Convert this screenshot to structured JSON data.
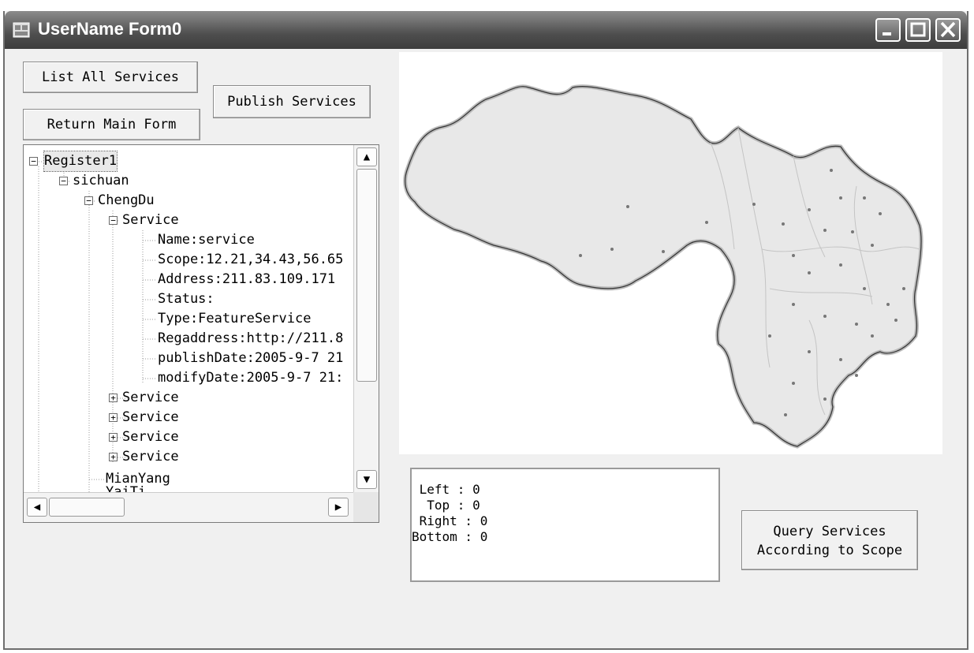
{
  "window": {
    "title": "UserName Form0"
  },
  "buttons": {
    "list_all": "List All Services",
    "publish": "Publish Services",
    "return_main": "Return Main Form",
    "query_line1": "Query Services",
    "query_line2": "According to Scope"
  },
  "tree": {
    "root": "Register1",
    "province": "sichuan",
    "city": "ChengDu",
    "service": "Service",
    "details": [
      "Name:service",
      "Scope:12.21,34.43,56.65",
      "Address:211.83.109.171",
      "Status:",
      "Type:FeatureService",
      "Regaddress:http://211.8",
      "publishDate:2005-9-7 21",
      "modifyDate:2005-9-7 21:"
    ],
    "collapsed_services": [
      "Service",
      "Service",
      "Service",
      "Service"
    ],
    "city2": "MianYang",
    "city3": "YaiTi..."
  },
  "coords": {
    "left": " Left : 0",
    "top": "  Top : 0",
    "right": " Right : 0",
    "bottom": "Bottom : 0"
  },
  "colors": {
    "titlebar": "#4f4f4f",
    "window_bg": "#f0f0f0",
    "map_fill": "#e8e8e8"
  }
}
